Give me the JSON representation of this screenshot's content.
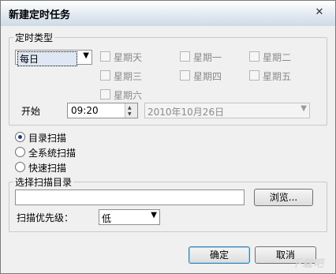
{
  "dialog": {
    "title": "新建定时任务",
    "close_glyph": "✕"
  },
  "schedule_type": {
    "legend": "定时类型",
    "frequency": {
      "value": "每日"
    },
    "weekdays": [
      {
        "label": "星期天",
        "checked": false
      },
      {
        "label": "星期一",
        "checked": false
      },
      {
        "label": "星期二",
        "checked": false
      },
      {
        "label": "星期三",
        "checked": false
      },
      {
        "label": "星期四",
        "checked": false
      },
      {
        "label": "星期五",
        "checked": false
      },
      {
        "label": "星期六",
        "checked": false
      }
    ],
    "start_label": "开始",
    "time_value": "09:20",
    "date_value": "2010年10月26日"
  },
  "scan_modes": [
    {
      "label": "目录扫描",
      "selected": true
    },
    {
      "label": "全系统扫描",
      "selected": false
    },
    {
      "label": "快速扫描",
      "selected": false
    }
  ],
  "scan_dir": {
    "legend": "选择扫描目录",
    "path_value": "",
    "browse_label": "浏览..."
  },
  "priority": {
    "label": "扫描优先级：",
    "value": "低"
  },
  "buttons": {
    "ok_label": "确定",
    "cancel_label": "取消"
  },
  "watermark": "下载吧"
}
